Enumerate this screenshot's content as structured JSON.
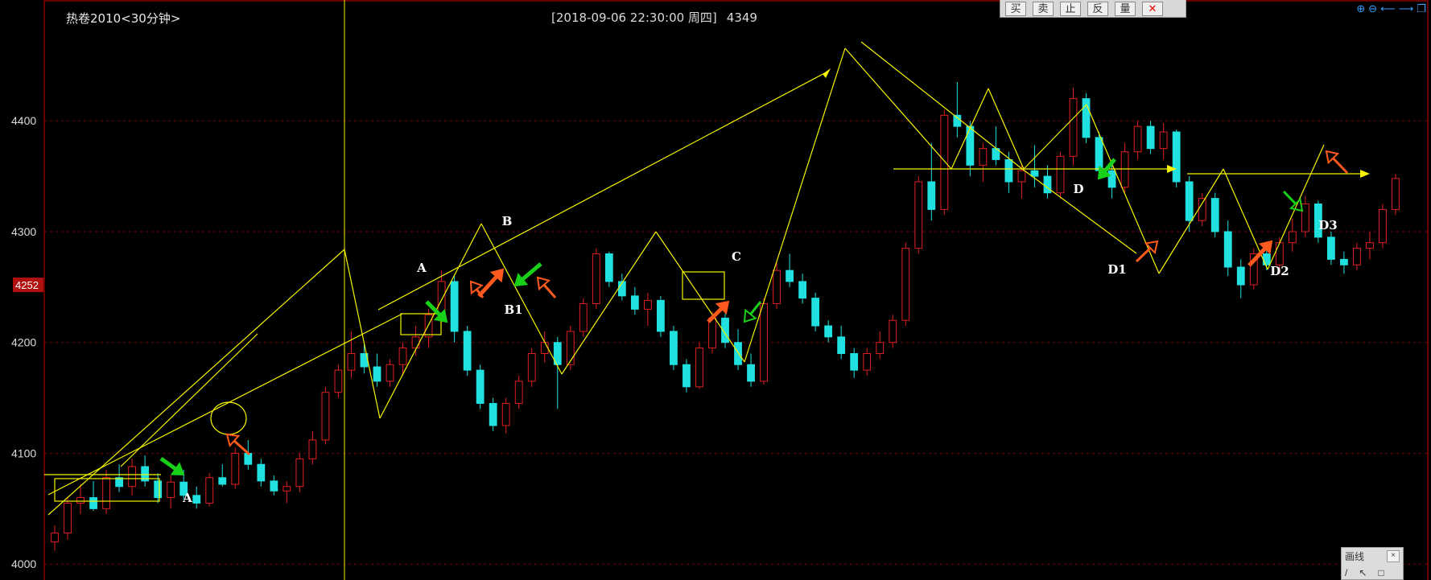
{
  "header": {
    "title": "热卷2010<30分钟>",
    "info": "[2018-09-06  22:30:00 周四]",
    "price": "4349"
  },
  "toolbar": {
    "buttons": [
      "买",
      "卖",
      "止",
      "反",
      "量"
    ],
    "delete_icon": "close-x-icon"
  },
  "top_right_icons": [
    "zoom-in-icon",
    "zoom-out-icon",
    "arrow-left-icon",
    "arrow-right-icon",
    "restore-icon"
  ],
  "draw_panel": {
    "title": "画线",
    "close": "×",
    "tools": [
      "/",
      "↖",
      "□"
    ]
  },
  "colors": {
    "background": "#000000",
    "up": "#e02020",
    "down": "#20e0e0",
    "grid": "#7a0000",
    "axis": "#8b0000",
    "annotation": "#f5f500",
    "arrow_red": "#ff5a1e",
    "arrow_green": "#18d018",
    "price_label_bg": "#b01010"
  },
  "chart_data": {
    "type": "candlestick",
    "title": "热卷2010<30分钟>",
    "ylim": [
      3990,
      4480
    ],
    "yticks": [
      4000,
      4100,
      4200,
      4300,
      4400
    ],
    "current_price_label": "4252",
    "grid": true,
    "candles": [
      {
        "o": 4020,
        "h": 4035,
        "l": 4012,
        "c": 4028
      },
      {
        "o": 4028,
        "h": 4060,
        "l": 4022,
        "c": 4055
      },
      {
        "o": 4055,
        "h": 4072,
        "l": 4045,
        "c": 4060
      },
      {
        "o": 4060,
        "h": 4075,
        "l": 4048,
        "c": 4050
      },
      {
        "o": 4050,
        "h": 4085,
        "l": 4045,
        "c": 4078
      },
      {
        "o": 4078,
        "h": 4090,
        "l": 4065,
        "c": 4070
      },
      {
        "o": 4070,
        "h": 4095,
        "l": 4062,
        "c": 4088
      },
      {
        "o": 4088,
        "h": 4098,
        "l": 4070,
        "c": 4075
      },
      {
        "o": 4075,
        "h": 4082,
        "l": 4055,
        "c": 4060
      },
      {
        "o": 4060,
        "h": 4080,
        "l": 4050,
        "c": 4074
      },
      {
        "o": 4074,
        "h": 4085,
        "l": 4058,
        "c": 4062
      },
      {
        "o": 4062,
        "h": 4070,
        "l": 4050,
        "c": 4055
      },
      {
        "o": 4055,
        "h": 4082,
        "l": 4052,
        "c": 4078
      },
      {
        "o": 4078,
        "h": 4090,
        "l": 4070,
        "c": 4072
      },
      {
        "o": 4072,
        "h": 4105,
        "l": 4068,
        "c": 4100
      },
      {
        "o": 4100,
        "h": 4112,
        "l": 4085,
        "c": 4090
      },
      {
        "o": 4090,
        "h": 4095,
        "l": 4070,
        "c": 4075
      },
      {
        "o": 4075,
        "h": 4080,
        "l": 4062,
        "c": 4066
      },
      {
        "o": 4066,
        "h": 4075,
        "l": 4055,
        "c": 4070
      },
      {
        "o": 4070,
        "h": 4100,
        "l": 4065,
        "c": 4095
      },
      {
        "o": 4095,
        "h": 4120,
        "l": 4090,
        "c": 4112
      },
      {
        "o": 4112,
        "h": 4160,
        "l": 4108,
        "c": 4155
      },
      {
        "o": 4155,
        "h": 4180,
        "l": 4150,
        "c": 4175
      },
      {
        "o": 4175,
        "h": 4210,
        "l": 4168,
        "c": 4190
      },
      {
        "o": 4190,
        "h": 4198,
        "l": 4172,
        "c": 4178
      },
      {
        "o": 4178,
        "h": 4190,
        "l": 4160,
        "c": 4165
      },
      {
        "o": 4165,
        "h": 4185,
        "l": 4160,
        "c": 4180
      },
      {
        "o": 4180,
        "h": 4200,
        "l": 4170,
        "c": 4195
      },
      {
        "o": 4195,
        "h": 4215,
        "l": 4188,
        "c": 4205
      },
      {
        "o": 4205,
        "h": 4230,
        "l": 4195,
        "c": 4225
      },
      {
        "o": 4225,
        "h": 4265,
        "l": 4218,
        "c": 4255
      },
      {
        "o": 4255,
        "h": 4260,
        "l": 4200,
        "c": 4210
      },
      {
        "o": 4210,
        "h": 4215,
        "l": 4170,
        "c": 4175
      },
      {
        "o": 4175,
        "h": 4180,
        "l": 4140,
        "c": 4145
      },
      {
        "o": 4145,
        "h": 4150,
        "l": 4120,
        "c": 4125
      },
      {
        "o": 4125,
        "h": 4150,
        "l": 4118,
        "c": 4145
      },
      {
        "o": 4145,
        "h": 4170,
        "l": 4140,
        "c": 4165
      },
      {
        "o": 4165,
        "h": 4195,
        "l": 4160,
        "c": 4190
      },
      {
        "o": 4190,
        "h": 4210,
        "l": 4182,
        "c": 4200
      },
      {
        "o": 4200,
        "h": 4205,
        "l": 4140,
        "c": 4180
      },
      {
        "o": 4180,
        "h": 4215,
        "l": 4175,
        "c": 4210
      },
      {
        "o": 4210,
        "h": 4240,
        "l": 4205,
        "c": 4235
      },
      {
        "o": 4235,
        "h": 4285,
        "l": 4230,
        "c": 4280
      },
      {
        "o": 4280,
        "h": 4282,
        "l": 4250,
        "c": 4255
      },
      {
        "o": 4255,
        "h": 4262,
        "l": 4238,
        "c": 4242
      },
      {
        "o": 4242,
        "h": 4250,
        "l": 4225,
        "c": 4230
      },
      {
        "o": 4230,
        "h": 4245,
        "l": 4215,
        "c": 4238
      },
      {
        "o": 4238,
        "h": 4242,
        "l": 4205,
        "c": 4210
      },
      {
        "o": 4210,
        "h": 4215,
        "l": 4175,
        "c": 4180
      },
      {
        "o": 4180,
        "h": 4185,
        "l": 4155,
        "c": 4160
      },
      {
        "o": 4160,
        "h": 4200,
        "l": 4158,
        "c": 4195
      },
      {
        "o": 4195,
        "h": 4228,
        "l": 4190,
        "c": 4222
      },
      {
        "o": 4222,
        "h": 4226,
        "l": 4195,
        "c": 4200
      },
      {
        "o": 4200,
        "h": 4212,
        "l": 4175,
        "c": 4180
      },
      {
        "o": 4180,
        "h": 4190,
        "l": 4160,
        "c": 4165
      },
      {
        "o": 4165,
        "h": 4240,
        "l": 4162,
        "c": 4235
      },
      {
        "o": 4235,
        "h": 4272,
        "l": 4230,
        "c": 4265
      },
      {
        "o": 4265,
        "h": 4280,
        "l": 4250,
        "c": 4255
      },
      {
        "o": 4255,
        "h": 4262,
        "l": 4235,
        "c": 4240
      },
      {
        "o": 4240,
        "h": 4245,
        "l": 4210,
        "c": 4215
      },
      {
        "o": 4215,
        "h": 4220,
        "l": 4200,
        "c": 4205
      },
      {
        "o": 4205,
        "h": 4215,
        "l": 4185,
        "c": 4190
      },
      {
        "o": 4190,
        "h": 4195,
        "l": 4168,
        "c": 4175
      },
      {
        "o": 4175,
        "h": 4195,
        "l": 4170,
        "c": 4190
      },
      {
        "o": 4190,
        "h": 4210,
        "l": 4185,
        "c": 4200
      },
      {
        "o": 4200,
        "h": 4225,
        "l": 4195,
        "c": 4220
      },
      {
        "o": 4220,
        "h": 4290,
        "l": 4215,
        "c": 4285
      },
      {
        "o": 4285,
        "h": 4350,
        "l": 4280,
        "c": 4345
      },
      {
        "o": 4345,
        "h": 4380,
        "l": 4310,
        "c": 4320
      },
      {
        "o": 4320,
        "h": 4410,
        "l": 4315,
        "c": 4405
      },
      {
        "o": 4405,
        "h": 4435,
        "l": 4385,
        "c": 4395
      },
      {
        "o": 4395,
        "h": 4400,
        "l": 4350,
        "c": 4360
      },
      {
        "o": 4360,
        "h": 4380,
        "l": 4345,
        "c": 4375
      },
      {
        "o": 4375,
        "h": 4395,
        "l": 4360,
        "c": 4365
      },
      {
        "o": 4365,
        "h": 4372,
        "l": 4335,
        "c": 4345
      },
      {
        "o": 4345,
        "h": 4360,
        "l": 4330,
        "c": 4355
      },
      {
        "o": 4355,
        "h": 4378,
        "l": 4340,
        "c": 4350
      },
      {
        "o": 4350,
        "h": 4360,
        "l": 4330,
        "c": 4335
      },
      {
        "o": 4335,
        "h": 4372,
        "l": 4330,
        "c": 4368
      },
      {
        "o": 4368,
        "h": 4430,
        "l": 4360,
        "c": 4420
      },
      {
        "o": 4420,
        "h": 4425,
        "l": 4380,
        "c": 4385
      },
      {
        "o": 4385,
        "h": 4390,
        "l": 4350,
        "c": 4355
      },
      {
        "o": 4355,
        "h": 4365,
        "l": 4330,
        "c": 4340
      },
      {
        "o": 4340,
        "h": 4380,
        "l": 4335,
        "c": 4372
      },
      {
        "o": 4372,
        "h": 4400,
        "l": 4365,
        "c": 4395
      },
      {
        "o": 4395,
        "h": 4400,
        "l": 4370,
        "c": 4375
      },
      {
        "o": 4375,
        "h": 4398,
        "l": 4365,
        "c": 4390
      },
      {
        "o": 4390,
        "h": 4392,
        "l": 4340,
        "c": 4345
      },
      {
        "o": 4345,
        "h": 4350,
        "l": 4300,
        "c": 4310
      },
      {
        "o": 4310,
        "h": 4335,
        "l": 4305,
        "c": 4330
      },
      {
        "o": 4330,
        "h": 4335,
        "l": 4295,
        "c": 4300
      },
      {
        "o": 4300,
        "h": 4310,
        "l": 4260,
        "c": 4268
      },
      {
        "o": 4268,
        "h": 4275,
        "l": 4240,
        "c": 4252
      },
      {
        "o": 4252,
        "h": 4285,
        "l": 4248,
        "c": 4280
      },
      {
        "o": 4280,
        "h": 4290,
        "l": 4265,
        "c": 4270
      },
      {
        "o": 4270,
        "h": 4295,
        "l": 4262,
        "c": 4290
      },
      {
        "o": 4290,
        "h": 4312,
        "l": 4282,
        "c": 4300
      },
      {
        "o": 4300,
        "h": 4332,
        "l": 4295,
        "c": 4325
      },
      {
        "o": 4325,
        "h": 4328,
        "l": 4290,
        "c": 4295
      },
      {
        "o": 4295,
        "h": 4300,
        "l": 4270,
        "c": 4275
      },
      {
        "o": 4275,
        "h": 4282,
        "l": 4262,
        "c": 4270
      },
      {
        "o": 4270,
        "h": 4290,
        "l": 4265,
        "c": 4285
      },
      {
        "o": 4285,
        "h": 4300,
        "l": 4275,
        "c": 4290
      },
      {
        "o": 4290,
        "h": 4325,
        "l": 4285,
        "c": 4320
      },
      {
        "o": 4320,
        "h": 4352,
        "l": 4315,
        "c": 4348
      }
    ],
    "annotations": {
      "labels": [
        {
          "text": "A",
          "i": 13,
          "v": 4045
        },
        {
          "text": "A",
          "i": 39,
          "v": 4245
        },
        {
          "text": "B",
          "i": 44,
          "v": 4288
        },
        {
          "text": "B1",
          "i": 46,
          "v": 4212
        },
        {
          "text": "C",
          "i": 67,
          "v": 4255
        },
        {
          "text": "D",
          "i": 90,
          "v": 4312
        },
        {
          "text": "D1",
          "i": 93,
          "v": 4245
        },
        {
          "text": "D2",
          "i": 98,
          "v": 4245
        },
        {
          "text": "D3",
          "i": 103,
          "v": 4288
        }
      ]
    }
  }
}
